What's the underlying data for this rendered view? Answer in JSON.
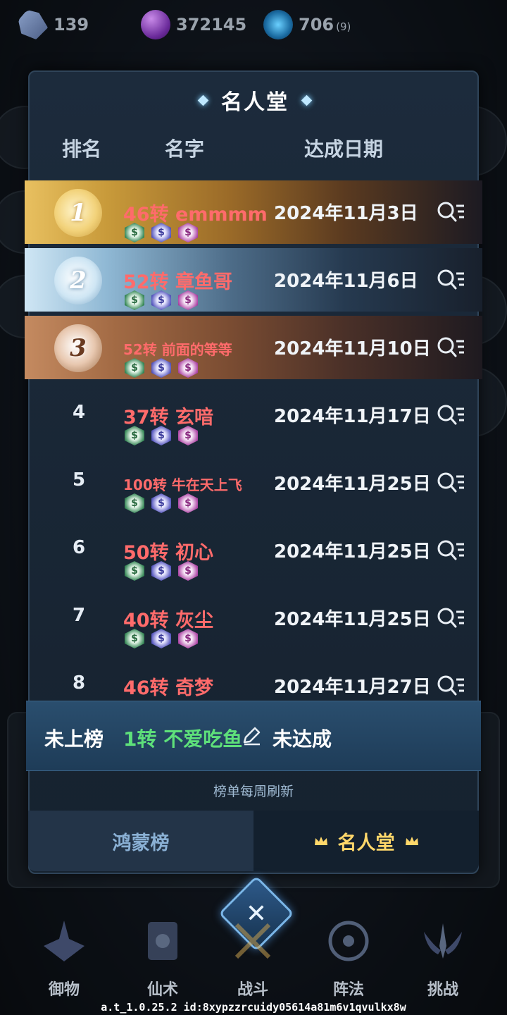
{
  "resources": [
    {
      "icon": "crystal-icon",
      "value": "139"
    },
    {
      "icon": "purple-orb-icon",
      "value": "372145"
    },
    {
      "icon": "energy-icon",
      "value": "706",
      "sub": "(9)"
    }
  ],
  "panel": {
    "title": "名人堂",
    "headers": {
      "rank": "排名",
      "name": "名字",
      "date": "达成日期"
    }
  },
  "rows": [
    {
      "rank": "1",
      "name": "46转 emmmm",
      "date": "2024年11月3日"
    },
    {
      "rank": "2",
      "name": "52转 章鱼哥",
      "date": "2024年11月6日"
    },
    {
      "rank": "3",
      "name": "52转 前面的等等",
      "date": "2024年11月10日"
    },
    {
      "rank": "4",
      "name": "37转 玄喑",
      "date": "2024年11月17日"
    },
    {
      "rank": "5",
      "name": "100转 牛在天上飞",
      "date": "2024年11月25日"
    },
    {
      "rank": "6",
      "name": "50转 初心",
      "date": "2024年11月25日"
    },
    {
      "rank": "7",
      "name": "40转 灰尘",
      "date": "2024年11月25日"
    },
    {
      "rank": "8",
      "name": "46转 奇梦",
      "date": "2024年11月27日"
    }
  ],
  "my_rank": {
    "label": "未上榜",
    "name": "1转 不爱吃鱼",
    "status": "未达成"
  },
  "refresh_note": "榜单每周刷新",
  "tabs": {
    "left": "鸿蒙榜",
    "right": "名人堂"
  },
  "nav": [
    "御物",
    "仙术",
    "战斗",
    "阵法",
    "挑战"
  ],
  "build_id": "a.t_1.0.25.2 id:8xypzzrcuidy05614a81m6v1qvulkx8w",
  "colors": {
    "name_red": "#ff6b6b",
    "my_name_green": "#5ee07a",
    "active_tab_gold": "#ffd76a",
    "panel_bg": "#1c2b3c"
  }
}
